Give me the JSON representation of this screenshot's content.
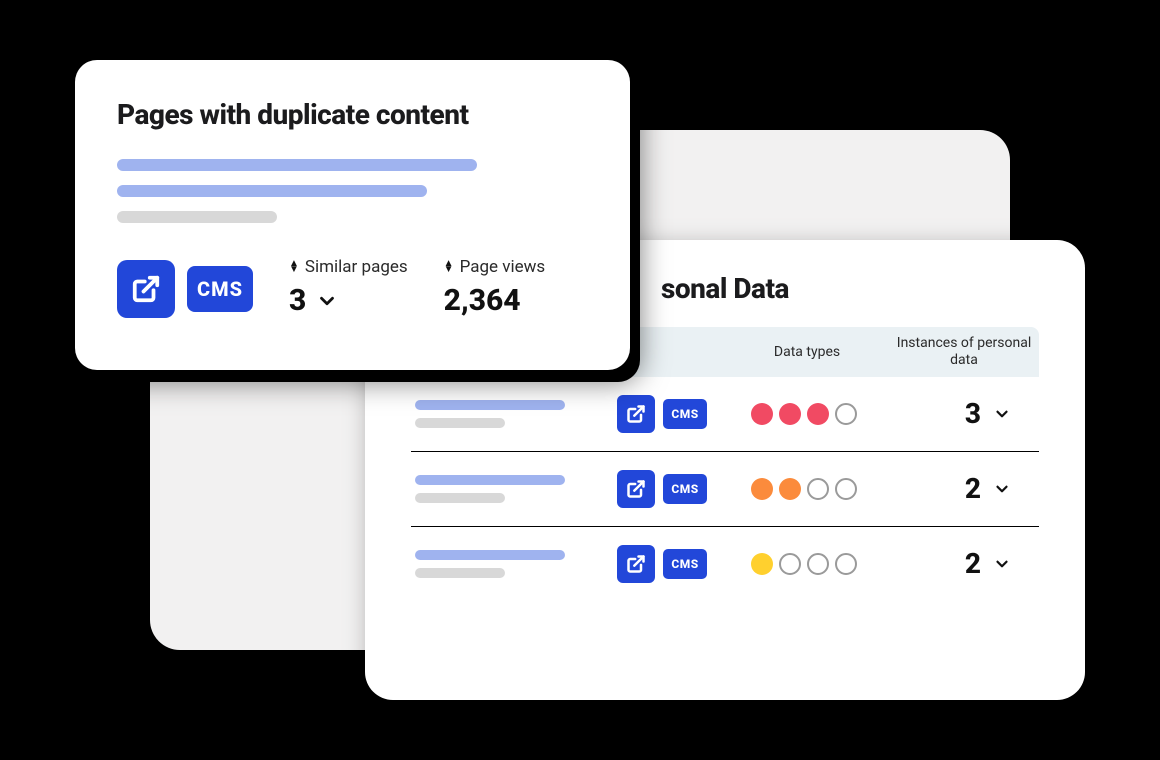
{
  "front_card": {
    "title": "Pages with duplicate content",
    "cms_label": "CMS",
    "similar_pages_label": "Similar pages",
    "similar_pages_value": "3",
    "page_views_label": "Page views",
    "page_views_value": "2,364"
  },
  "pd_card": {
    "title_fragment": "sonal Data",
    "header_data_types": "Data types",
    "header_instances": "Instances of personal data",
    "cms_label": "CMS",
    "rows": [
      {
        "dots": [
          "red",
          "red",
          "red",
          "empty"
        ],
        "count": "3"
      },
      {
        "dots": [
          "orange",
          "orange",
          "empty",
          "empty"
        ],
        "count": "2"
      },
      {
        "dots": [
          "yellow",
          "empty",
          "empty",
          "empty"
        ],
        "count": "2"
      }
    ]
  },
  "colors": {
    "accent_blue": "#2247d9",
    "placeholder_blue": "#9fb3ef",
    "placeholder_grey": "#d8d8d8",
    "dot_red": "#f14a63",
    "dot_orange": "#fb8b3c",
    "dot_yellow": "#ffd02e"
  }
}
